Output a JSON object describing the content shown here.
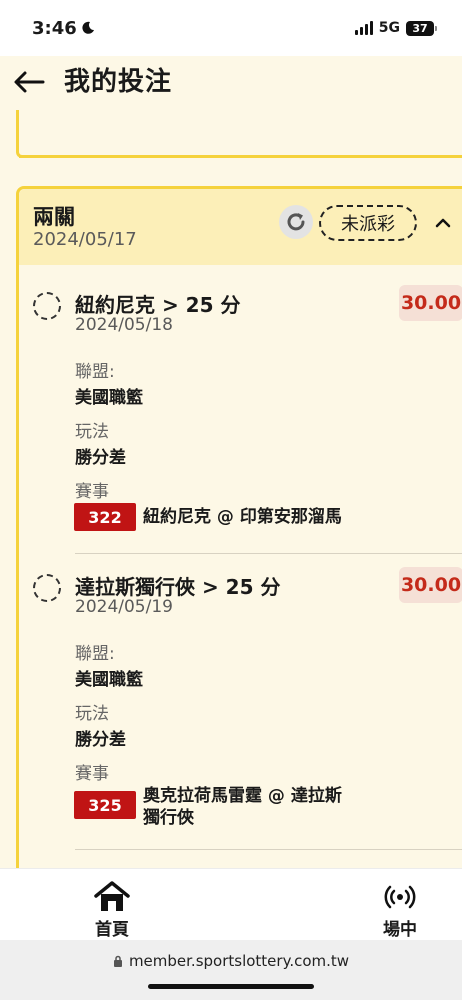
{
  "status_bar": {
    "time": "3:46",
    "network": "5G",
    "battery": "37"
  },
  "header": {
    "title": "我的投注"
  },
  "bet": {
    "type": "兩關",
    "date": "2024/05/17",
    "status": "未派彩",
    "legs": [
      {
        "selection": "紐約尼克 > 25 分",
        "date": "2024/05/18",
        "odds": "30.00",
        "league_label": "聯盟:",
        "league": "美國職籃",
        "play_label": "玩法",
        "play": "勝分差",
        "match_label": "賽事",
        "match_id": "322",
        "match_name_line1": "紐約尼克 @ 印第安那溜馬",
        "match_name_line2": ""
      },
      {
        "selection": "達拉斯獨行俠 > 25 分",
        "date": "2024/05/19",
        "odds": "30.00",
        "league_label": "聯盟:",
        "league": "美國職籃",
        "play_label": "玩法",
        "play": "勝分差",
        "match_label": "賽事",
        "match_id": "325",
        "match_name_line1": "奧克拉荷馬雷霆 @ 達拉斯",
        "match_name_line2": "獨行俠"
      }
    ]
  },
  "bottom_nav": {
    "home": "首頁",
    "live": "場中"
  },
  "url_bar": {
    "url": "member.sportslottery.com.tw"
  },
  "colors": {
    "accent": "#f5d23c",
    "odds_text": "#c42a1a",
    "match_badge": "#c01414"
  }
}
